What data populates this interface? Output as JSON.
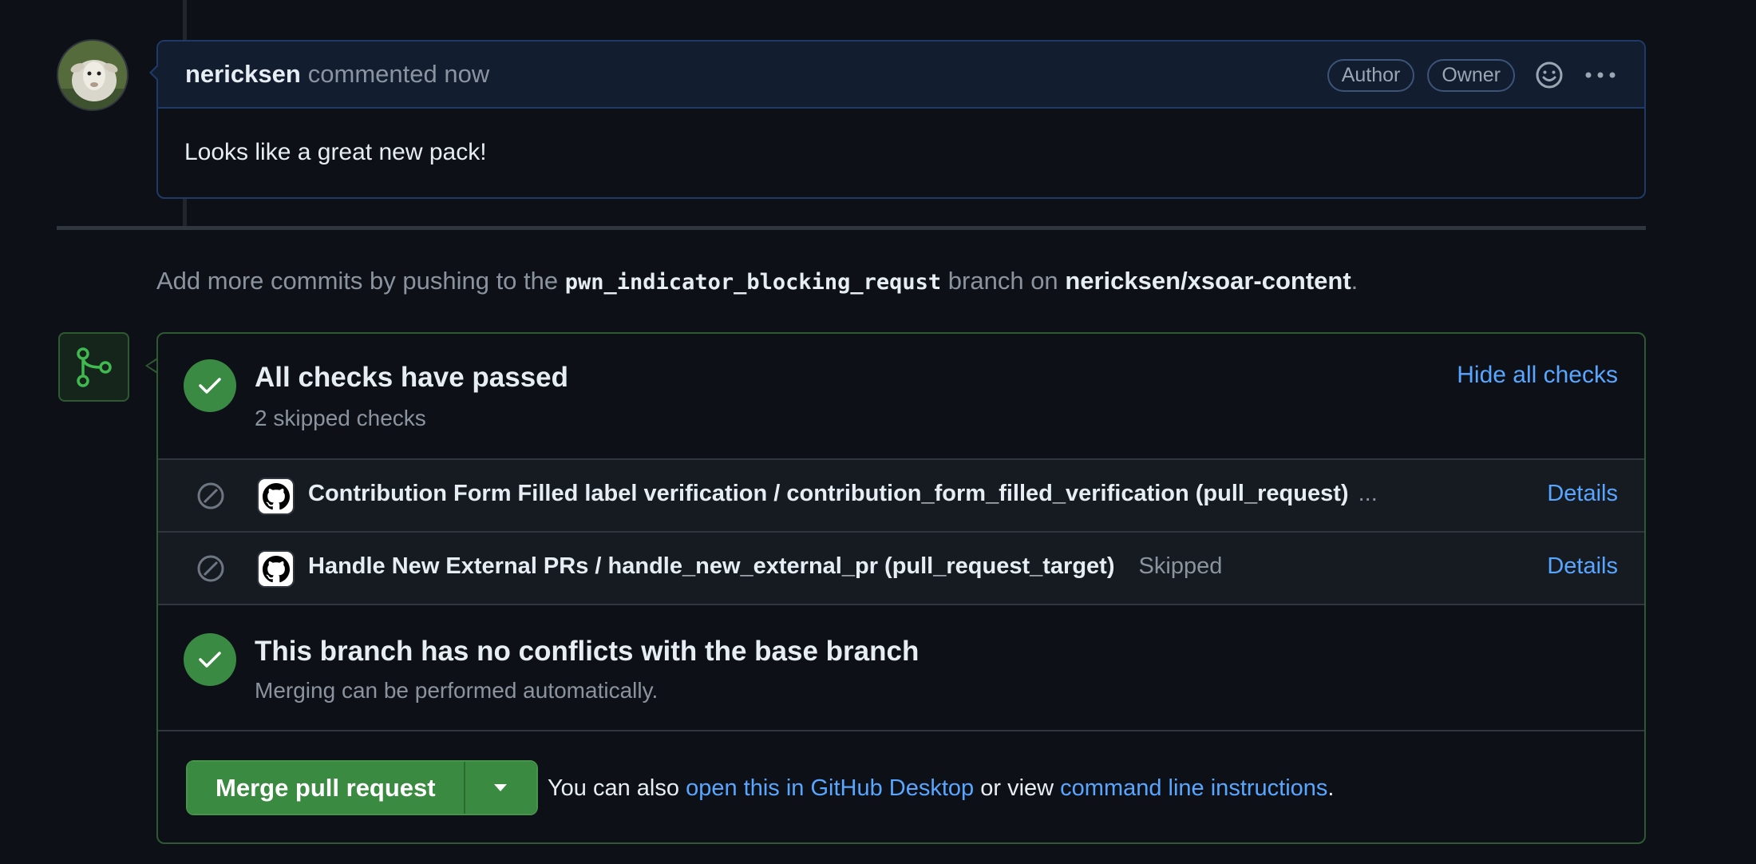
{
  "comment": {
    "author": "nericksen",
    "meta": "commented now",
    "badges": [
      "Author",
      "Owner"
    ],
    "body": "Looks like a great new pack!"
  },
  "commit_hint": {
    "prefix": "Add more commits by pushing to the",
    "branch": "pwn_indicator_blocking_requst",
    "middle": "branch on",
    "repo": "nericksen/xsoar-content",
    "suffix": "."
  },
  "checks": {
    "title": "All checks have passed",
    "subtitle": "2 skipped checks",
    "hide_label": "Hide all checks",
    "items": [
      {
        "name": "Contribution Form Filled label verification / contribution_form_filled_verification (pull_request)",
        "ellipsis": "...",
        "status": "",
        "details": "Details"
      },
      {
        "name": "Handle New External PRs / handle_new_external_pr (pull_request_target)",
        "ellipsis": "",
        "status": "Skipped",
        "details": "Details"
      }
    ]
  },
  "conflicts": {
    "title": "This branch has no conflicts with the base branch",
    "subtitle": "Merging can be performed automatically."
  },
  "merge": {
    "button_label": "Merge pull request",
    "hint_prefix": "You can also",
    "desktop_link": "open this in GitHub Desktop",
    "hint_middle": "or view",
    "cli_link": "command line instructions",
    "hint_suffix": "."
  },
  "colors": {
    "background": "#0d1117",
    "accent_link": "#58a6ff",
    "success": "#3b8a41",
    "comment_border": "#1f3a66"
  },
  "icons": [
    "sheep-avatar",
    "smiley-icon",
    "kebab-menu-icon",
    "git-merge-icon",
    "check-icon",
    "skip-icon",
    "github-icon",
    "chevron-down-icon"
  ]
}
